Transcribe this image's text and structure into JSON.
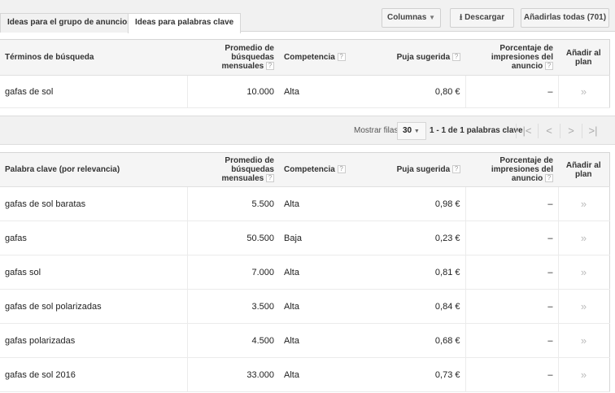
{
  "tabs": [
    {
      "label": "Ideas para el grupo de anuncios"
    },
    {
      "label": "Ideas para palabras clave"
    }
  ],
  "toolbar": {
    "columns": "Columnas",
    "download": "Descargar",
    "add_all": "Añadirlas todas (701)"
  },
  "columns": {
    "search_volume": "Promedio de búsquedas mensuales",
    "competition": "Competencia",
    "bid": "Puja sugerida",
    "impression_share": "Porcentaje de impresiones del anuncio",
    "add": "Añadir al plan",
    "help": "?"
  },
  "search_terms": {
    "header": "Términos de búsqueda",
    "rows": [
      {
        "term": "gafas de sol",
        "volume": "10.000",
        "competition": "Alta",
        "bid": "0,80 €",
        "share": "–"
      }
    ]
  },
  "pagination": {
    "rows_label": "Mostrar filas:",
    "rows_value": "30",
    "range": "1 - 1 de 1 palabras clave"
  },
  "keywords": {
    "header": "Palabra clave (por relevancia)",
    "rows": [
      {
        "term": "gafas de sol baratas",
        "volume": "5.500",
        "competition": "Alta",
        "bid": "0,98 €",
        "share": "–"
      },
      {
        "term": "gafas",
        "volume": "50.500",
        "competition": "Baja",
        "bid": "0,23 €",
        "share": "–"
      },
      {
        "term": "gafas sol",
        "volume": "7.000",
        "competition": "Alta",
        "bid": "0,81 €",
        "share": "–"
      },
      {
        "term": "gafas de sol polarizadas",
        "volume": "3.500",
        "competition": "Alta",
        "bid": "0,84 €",
        "share": "–"
      },
      {
        "term": "gafas polarizadas",
        "volume": "4.500",
        "competition": "Alta",
        "bid": "0,68 €",
        "share": "–"
      },
      {
        "term": "gafas de sol 2016",
        "volume": "33.000",
        "competition": "Alta",
        "bid": "0,73 €",
        "share": "–"
      }
    ]
  },
  "icons": {
    "add": "»"
  }
}
